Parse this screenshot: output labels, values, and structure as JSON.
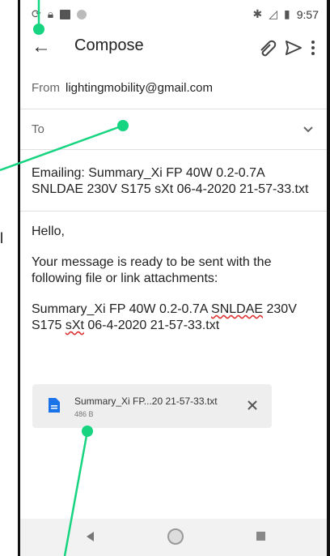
{
  "status_bar": {
    "time": "9:57"
  },
  "app_bar": {
    "title": "Compose"
  },
  "from": {
    "label": "From",
    "value": "lightingmobility@gmail.com"
  },
  "to": {
    "label": "To"
  },
  "subject": {
    "text": "Emailing: Summary_Xi FP 40W 0.2-0.7A SNLDAE 230V S175 sXt 06-4-2020 21-57-33.txt"
  },
  "body": {
    "greeting": "Hello,",
    "paragraph": "Your message is ready to be sent with the following file or link attachments:",
    "line_a": "Summary_Xi FP 40W 0.2-0.7A ",
    "word_snldae": "SNLDAE",
    "line_b": " 230V S175 ",
    "word_sxt": "sXt",
    "line_c": " 06-4-2020 21-57-33.txt"
  },
  "attachment": {
    "name": "Summary_Xi FP...20 21-57-33.txt",
    "size": "486 B"
  },
  "side_text": "l",
  "colors": {
    "marker": "#16d480",
    "doc_icon": "#1a73e8",
    "accent_text": "#222222"
  }
}
